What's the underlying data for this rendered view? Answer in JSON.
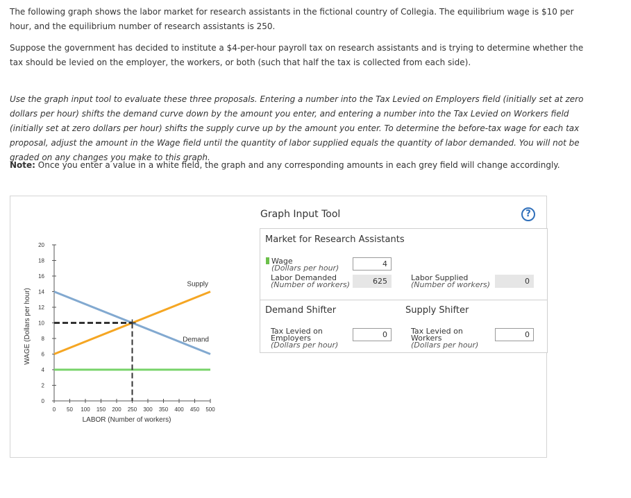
{
  "intro": {
    "p1": "The following graph shows the labor market for research assistants in the fictional country of Collegia. The equilibrium wage is $10 per hour, and the equilibrium number of research assistants is 250.",
    "p2": "Suppose the government has decided to institute a $4-per-hour payroll tax on research assistants and is trying to determine whether the tax should be levied on the employer, the workers, or both (such that half the tax is collected from each side).",
    "p3": "Use the graph input tool to evaluate these three proposals. Entering a number into the Tax Levied on Employers field (initially set at zero dollars per hour) shifts the demand curve down by the amount you enter, and entering a number into the Tax Levied on Workers field (initially set at zero dollars per hour) shifts the supply curve up by the amount you enter. To determine the before-tax wage for each tax proposal, adjust the amount in the Wage field until the quantity of labor supplied equals the quantity of labor demanded. You will not be graded on any changes you make to this graph.",
    "note_label": "Note:",
    "note_text": " Once you enter a value in a white field, the graph and any corresponding amounts in each grey field will change accordingly."
  },
  "chart_data": {
    "type": "line",
    "xlabel": "LABOR (Number of workers)",
    "ylabel": "WAGE (Dollars per hour)",
    "xlim": [
      0,
      500
    ],
    "ylim": [
      0,
      20
    ],
    "xticks": [
      0,
      50,
      100,
      150,
      200,
      250,
      300,
      350,
      400,
      450,
      500
    ],
    "yticks": [
      0,
      2,
      4,
      6,
      8,
      10,
      12,
      14,
      16,
      18,
      20
    ],
    "series": [
      {
        "name": "Supply",
        "color": "#f5a623",
        "x": [
          0,
          500
        ],
        "y": [
          6,
          14
        ]
      },
      {
        "name": "Demand",
        "color": "#82a9d0",
        "x": [
          0,
          500
        ],
        "y": [
          14,
          6
        ]
      },
      {
        "name": "",
        "color": "#78d36a",
        "x": [
          0,
          500
        ],
        "y": [
          4,
          4
        ]
      }
    ],
    "equilibrium": {
      "x": 250,
      "y": 10
    }
  },
  "tool": {
    "title": "Graph Input Tool",
    "help": "?",
    "market": {
      "title": "Market for Research Assistants",
      "wage_label": "Wage",
      "wage_unit": "(Dollars per hour)",
      "wage_value": "4",
      "demanded_label": "Labor Demanded",
      "demanded_unit": "(Number of workers)",
      "demanded_value": "625",
      "supplied_label": "Labor Supplied",
      "supplied_unit": "(Number of workers)",
      "supplied_value": "0"
    },
    "demand_shifter": {
      "title": "Demand Shifter",
      "label_l1": "Tax Levied on",
      "label_l2": "Employers",
      "unit": "(Dollars per hour)",
      "value": "0"
    },
    "supply_shifter": {
      "title": "Supply Shifter",
      "label_l1": "Tax Levied on",
      "label_l2": "Workers",
      "unit": "(Dollars per hour)",
      "value": "0"
    }
  },
  "colors": {
    "help": "#2f6fba",
    "wage_legend": "#6cc04a"
  }
}
